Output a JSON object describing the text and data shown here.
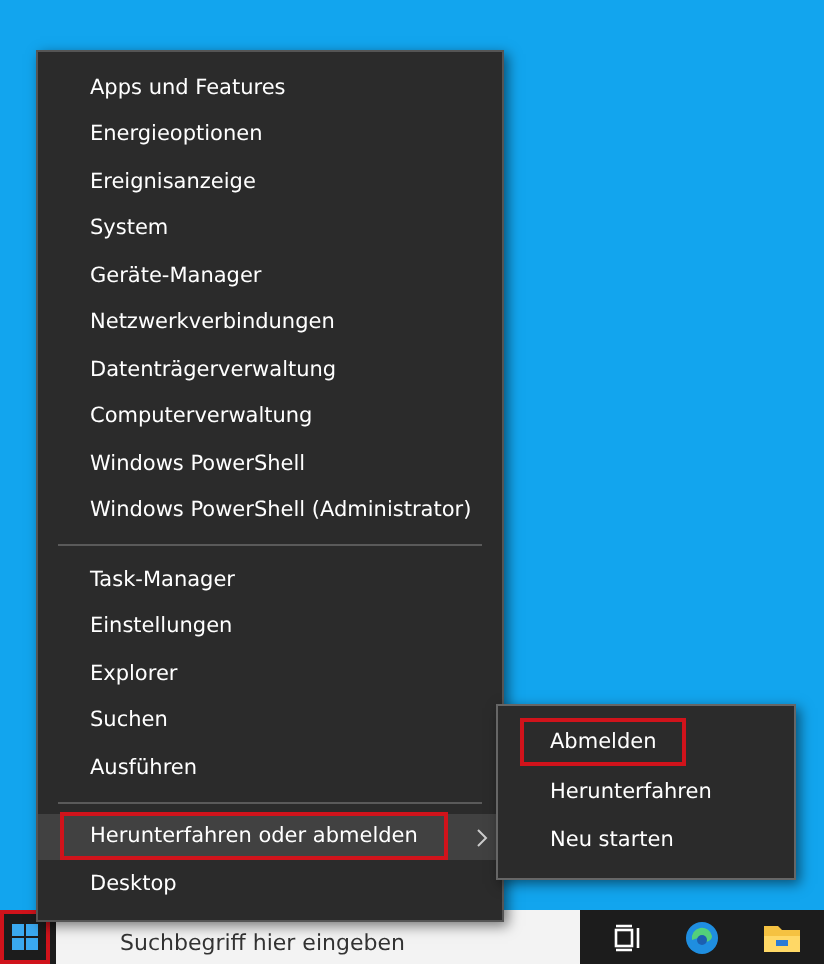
{
  "context_menu": {
    "groups": [
      {
        "items": [
          {
            "label": "Apps und Features",
            "selected": false,
            "marked": false
          },
          {
            "label": "Energieoptionen",
            "selected": false,
            "marked": false
          },
          {
            "label": "Ereignisanzeige",
            "selected": false,
            "marked": false
          },
          {
            "label": "System",
            "selected": false,
            "marked": false
          },
          {
            "label": "Geräte-Manager",
            "selected": false,
            "marked": false
          },
          {
            "label": "Netzwerkverbindungen",
            "selected": false,
            "marked": false
          },
          {
            "label": "Datenträgerverwaltung",
            "selected": false,
            "marked": false
          },
          {
            "label": "Computerverwaltung",
            "selected": false,
            "marked": false
          },
          {
            "label": "Windows PowerShell",
            "selected": false,
            "marked": false
          },
          {
            "label": "Windows PowerShell (Administrator)",
            "selected": false,
            "marked": false
          }
        ]
      },
      {
        "items": [
          {
            "label": "Task-Manager",
            "selected": false,
            "marked": false
          },
          {
            "label": "Einstellungen",
            "selected": false,
            "marked": false
          },
          {
            "label": "Explorer",
            "selected": false,
            "marked": false
          },
          {
            "label": "Suchen",
            "selected": false,
            "marked": false
          },
          {
            "label": "Ausführen",
            "selected": false,
            "marked": false
          }
        ]
      },
      {
        "items": [
          {
            "label": "Herunterfahren oder abmelden",
            "selected": true,
            "marked": true,
            "submenu": [
              {
                "label": "Abmelden",
                "marked": true
              },
              {
                "label": "Herunterfahren",
                "marked": false
              },
              {
                "label": "Neu starten",
                "marked": false
              }
            ]
          },
          {
            "label": "Desktop",
            "selected": false,
            "marked": false
          }
        ]
      }
    ]
  },
  "taskbar": {
    "start_button": {
      "marked": true
    },
    "search": {
      "placeholder": "Suchbegriff hier eingeben"
    }
  }
}
